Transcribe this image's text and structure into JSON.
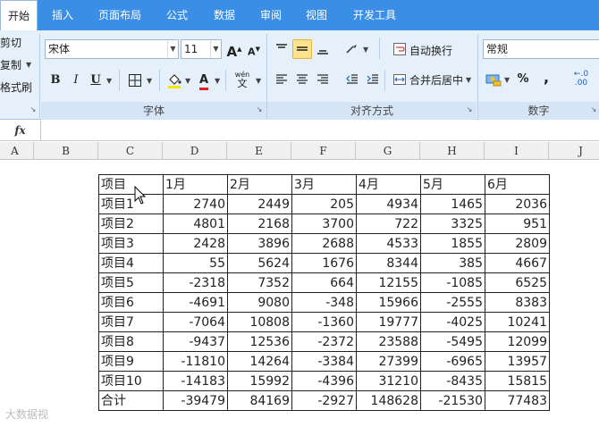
{
  "ribbon_tabs": [
    {
      "label": "开始"
    },
    {
      "label": "插入"
    },
    {
      "label": "页面布局"
    },
    {
      "label": "公式"
    },
    {
      "label": "数据"
    },
    {
      "label": "审阅"
    },
    {
      "label": "视图"
    },
    {
      "label": "开发工具"
    }
  ],
  "clipboard": {
    "cut": "剪切",
    "copy": "复制",
    "format_painter": "格式刷"
  },
  "font": {
    "name": "宋体",
    "size": "11",
    "grow_glyph": "A",
    "shrink_glyph": "A",
    "bold": "B",
    "italic": "I",
    "underline": "U",
    "font_color_glyph": "A",
    "phonetic_top": "wén",
    "phonetic_bottom": "文",
    "group_label": "字体"
  },
  "alignment": {
    "wrap_text": "自动换行",
    "merge_center": "合并后居中",
    "group_label": "对齐方式"
  },
  "number": {
    "format": "常规",
    "percent": "%",
    "comma": ",",
    "group_label": "数字"
  },
  "formula_bar": {
    "fx": "fx",
    "value": ""
  },
  "columns": [
    "A",
    "B",
    "C",
    "D",
    "E",
    "F",
    "G",
    "H",
    "I",
    "J"
  ],
  "table": {
    "headers": [
      "项目",
      "1月",
      "2月",
      "3月",
      "4月",
      "5月",
      "6月"
    ],
    "rows": [
      {
        "label": "项目1",
        "values": [
          "2740",
          "2449",
          "205",
          "4934",
          "1465",
          "2036"
        ]
      },
      {
        "label": "项目2",
        "values": [
          "4801",
          "2168",
          "3700",
          "722",
          "3325",
          "951"
        ]
      },
      {
        "label": "项目3",
        "values": [
          "2428",
          "3896",
          "2688",
          "4533",
          "1855",
          "2809"
        ]
      },
      {
        "label": "项目4",
        "values": [
          "55",
          "5624",
          "1676",
          "8344",
          "385",
          "4667"
        ]
      },
      {
        "label": "项目5",
        "values": [
          "-2318",
          "7352",
          "664",
          "12155",
          "-1085",
          "6525"
        ]
      },
      {
        "label": "项目6",
        "values": [
          "-4691",
          "9080",
          "-348",
          "15966",
          "-2555",
          "8383"
        ]
      },
      {
        "label": "项目7",
        "values": [
          "-7064",
          "10808",
          "-1360",
          "19777",
          "-4025",
          "10241"
        ]
      },
      {
        "label": "项目8",
        "values": [
          "-9437",
          "12536",
          "-2372",
          "23588",
          "-5495",
          "12099"
        ]
      },
      {
        "label": "项目9",
        "values": [
          "-11810",
          "14264",
          "-3384",
          "27399",
          "-6965",
          "13957"
        ]
      },
      {
        "label": "项目10",
        "values": [
          "-14183",
          "15992",
          "-4396",
          "31210",
          "-8435",
          "15815"
        ]
      }
    ],
    "total": {
      "label": "合计",
      "values": [
        "-39479",
        "84169",
        "-2927",
        "148628",
        "-21530",
        "77483"
      ]
    }
  },
  "watermark": "大数据视",
  "colors": {
    "tab_bar": "#3a8ee6",
    "ribbon_bg": "#e6f0fb",
    "selected_button": "#fde38e",
    "grid_border": "#222222"
  }
}
